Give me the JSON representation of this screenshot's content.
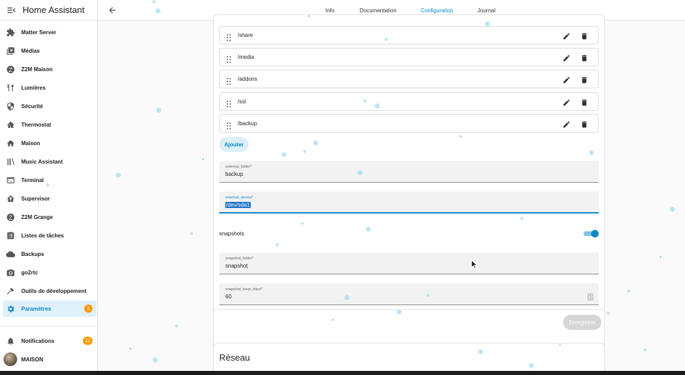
{
  "sidebar": {
    "title": "Home Assistant",
    "items": [
      {
        "label": "Matter Server",
        "icon": "puzzle-icon"
      },
      {
        "label": "Médias",
        "icon": "media-play-icon"
      },
      {
        "label": "Z2M Maison",
        "icon": "zigbee-icon"
      },
      {
        "label": "Lumières",
        "icon": "lamp-icon"
      },
      {
        "label": "Sécurité",
        "icon": "shield-icon"
      },
      {
        "label": "Thermostat",
        "icon": "thermostat-icon"
      },
      {
        "label": "Maison",
        "icon": "home-icon"
      },
      {
        "label": "Music Assistant",
        "icon": "music-library-icon"
      },
      {
        "label": "Terminal",
        "icon": "terminal-icon"
      },
      {
        "label": "Supervisor",
        "icon": "supervisor-icon"
      },
      {
        "label": "Z2M Grange",
        "icon": "zigbee-icon"
      },
      {
        "label": "Listes de tâches",
        "icon": "clipboard-list-icon"
      },
      {
        "label": "Backups",
        "icon": "cloud-upload-icon"
      },
      {
        "label": "go2rtc",
        "icon": "camera-icon"
      },
      {
        "label": "Outils de développement",
        "icon": "hammer-icon"
      },
      {
        "label": "Paramètres",
        "icon": "gear-icon",
        "badge": "3"
      }
    ],
    "notifications": {
      "label": "Notifications",
      "badge": "22"
    },
    "user": {
      "label": "MAISON"
    }
  },
  "topbar": {
    "tabs": [
      {
        "label": "Info"
      },
      {
        "label": "Documentation"
      },
      {
        "label": "Configuration"
      },
      {
        "label": "Journal"
      }
    ],
    "active_tab": "Configuration"
  },
  "config": {
    "folders": [
      "/share",
      "/media",
      "/addons",
      "/ssl",
      "/backup"
    ],
    "add_label": "Ajouter",
    "external_folder": {
      "label": "external_folder*",
      "value": "backup"
    },
    "external_device": {
      "label": "external_device*",
      "value": "/dev/sda1"
    },
    "snapshots": {
      "label": "snapshots",
      "enabled": true
    },
    "snapshot_folder": {
      "label": "snapshot_folder*",
      "value": "snapshot"
    },
    "snapshot_keep_days": {
      "label": "snapshot_keep_days*",
      "value": "60"
    },
    "save_label": "Enregistrer"
  },
  "network": {
    "title": "Réseau"
  },
  "colors": {
    "accent": "#0b88c8",
    "badge": "#ff9800",
    "active_bg": "#dff0fa"
  }
}
